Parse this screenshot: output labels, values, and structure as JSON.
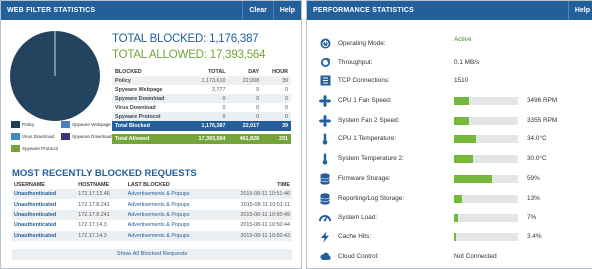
{
  "web_filter": {
    "title": "WEB FILTER STATISTICS",
    "clear_label": "Clear",
    "help_label": "Help",
    "total_blocked": "TOTAL BLOCKED: 1,176,387",
    "total_allowed": "TOTAL ALLOWED: 17,393,564",
    "pie_colors": {
      "main": "#23435e",
      "border": "#ffffff"
    },
    "legend": [
      {
        "label": "Policy",
        "color": "#1e3f5a"
      },
      {
        "label": "Spyware Webpage",
        "color": "#4a7fb8"
      },
      {
        "label": "Virus Download",
        "color": "#3e8cc4"
      },
      {
        "label": "Spyware Download",
        "color": "#3a3379"
      },
      {
        "label": "Spyware Protocol",
        "color": "#74a43a"
      }
    ],
    "table_headers": [
      "BLOCKED",
      "TOTAL",
      "DAY",
      "HOUR"
    ],
    "table_rows": [
      [
        "Policy",
        "1,173,610",
        "22,008",
        "39"
      ],
      [
        "Spyware Webpage",
        "2,777",
        "9",
        "0"
      ],
      [
        "Spyware Download",
        "0",
        "0",
        "0"
      ],
      [
        "Virus Download",
        "0",
        "0",
        "0"
      ],
      [
        "Spyware Protocol",
        "0",
        "0",
        "0"
      ]
    ],
    "total_blocked_row": [
      "Total Blocked",
      "1,176,387",
      "22,017",
      "39"
    ],
    "total_allowed_row": [
      "Total Allowed",
      "17,393,564",
      "461,828",
      "291"
    ],
    "recent_title": "MOST RECENTLY BLOCKED REQUESTS",
    "recent_headers": [
      "USERNAME",
      "HOSTNAME",
      "LAST BLOCKED",
      "TIME"
    ],
    "recent_rows": [
      [
        "Unauthenticated",
        "172.17.13.46",
        "Advertisements & Popups",
        "2015-08-11 10:51:46"
      ],
      [
        "Unauthenticated",
        "172.17.8.241",
        "Advertisements & Popups",
        "2015-08-11 10:51:11"
      ],
      [
        "Unauthenticated",
        "172.17.8.241",
        "Advertisements & Popups",
        "2015-08-11 10:50:49"
      ],
      [
        "Unauthenticated",
        "172.17.14.3",
        "Advertisements & Popups",
        "2015-08-11 10:50:44"
      ],
      [
        "Unauthenticated",
        "172.17.14.3",
        "Advertisements & Popups",
        "2015-08-11 10:50:43"
      ]
    ],
    "show_all_label": "Show All Blocked Requests"
  },
  "performance": {
    "title": "PERFORMANCE STATISTICS",
    "help_label": "Help",
    "rows": [
      {
        "label": "Operating Mode:",
        "icon": "power-icon",
        "value": "Active",
        "kind": "text",
        "class": "active"
      },
      {
        "label": "Throughput:",
        "icon": "refresh-icon",
        "value": "0.1 MB/s",
        "kind": "text"
      },
      {
        "label": "TCP Connections:",
        "icon": "connections-icon",
        "value": "1510",
        "kind": "text"
      },
      {
        "label": "CPU 1 Fan Speed:",
        "icon": "fan-icon",
        "value": "3496 RPM",
        "kind": "bar",
        "fill": 0.24
      },
      {
        "label": "System Fan 2 Speed:",
        "icon": "fan-icon",
        "value": "3355 RPM",
        "kind": "bar",
        "fill": 0.23
      },
      {
        "label": "CPU 1 Temperature:",
        "icon": "thermometer-icon",
        "value": "34.0°C",
        "kind": "bar",
        "fill": 0.34
      },
      {
        "label": "System Temperature 2:",
        "icon": "thermometer-icon",
        "value": "30.0°C",
        "kind": "bar",
        "fill": 0.3
      },
      {
        "label": "Firmware Storage:",
        "icon": "database-icon",
        "value": "59%",
        "kind": "bar",
        "fill": 0.59
      },
      {
        "label": "Reporting/Log Storage:",
        "icon": "database-icon",
        "value": "13%",
        "kind": "bar",
        "fill": 0.13
      },
      {
        "label": "System Load:",
        "icon": "gauge-icon",
        "value": "7%",
        "kind": "bar",
        "fill": 0.07
      },
      {
        "label": "Cache Hits:",
        "icon": "lightning-icon",
        "value": "3.4%",
        "kind": "bar",
        "fill": 0.034
      },
      {
        "label": "Cloud Control:",
        "icon": "cloud-icon",
        "value": "Not Connected",
        "kind": "text"
      }
    ]
  }
}
